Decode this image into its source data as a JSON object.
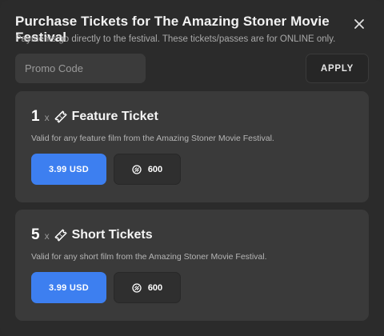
{
  "modal": {
    "title": "Purchase Tickets for The Amazing Stoner Movie Festival",
    "subtitle": "Payments go directly to the festival. These tickets/passes are for ONLINE only.",
    "close_icon": "close-icon"
  },
  "promo": {
    "value": "",
    "placeholder": "Promo Code",
    "apply_label": "APPLY"
  },
  "tickets": [
    {
      "quantity": "1",
      "times": "x",
      "icon": "ticket-icon",
      "name": "Feature Ticket",
      "description": "Valid for any feature film from the Amazing Stoner Movie Festival.",
      "price_label": "3.99 USD",
      "points_icon": "coin-icon",
      "points": "600"
    },
    {
      "quantity": "5",
      "times": "x",
      "icon": "ticket-icon",
      "name": "Short Tickets",
      "description": "Valid for any short film from the Amazing Stoner Movie Festival.",
      "price_label": "3.99 USD",
      "points_icon": "coin-icon",
      "points": "600"
    }
  ],
  "colors": {
    "background": "#2b2b2b",
    "card": "#3a3a3a",
    "accent": "#3d7ff0"
  }
}
